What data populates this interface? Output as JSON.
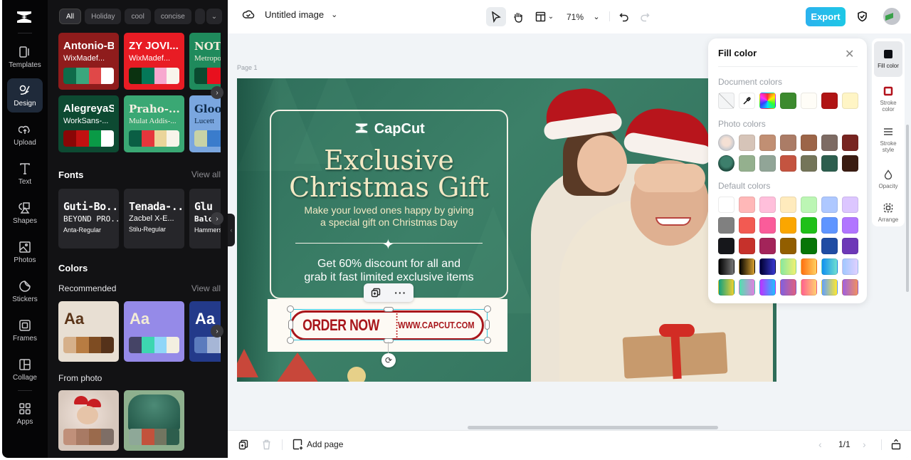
{
  "rail": {
    "items": [
      {
        "label": "Templates",
        "icon": "templates-icon"
      },
      {
        "label": "Design",
        "icon": "design-icon",
        "active": true
      },
      {
        "label": "Upload",
        "icon": "upload-icon"
      },
      {
        "label": "Text",
        "icon": "text-icon"
      },
      {
        "label": "Shapes",
        "icon": "shapes-icon"
      },
      {
        "label": "Photos",
        "icon": "photos-icon"
      },
      {
        "label": "Stickers",
        "icon": "stickers-icon"
      },
      {
        "label": "Frames",
        "icon": "frames-icon"
      },
      {
        "label": "Collage",
        "icon": "collage-icon"
      },
      {
        "label": "Apps",
        "icon": "apps-icon"
      }
    ]
  },
  "panel": {
    "chips": [
      "All",
      "Holiday",
      "cool",
      "concise"
    ],
    "themes": [
      {
        "title": "Antonio-Bold",
        "subtitle": "WixMadef...",
        "bg": "#8f1c1c",
        "fg": "#ffffff",
        "palette": [
          "#0f6b4a",
          "#3aa77d",
          "#e04848",
          "#ffffff"
        ]
      },
      {
        "title": "ZY JOVI...",
        "subtitle": "WixMadef...",
        "bg": "#e81c24",
        "fg": "#ffffff",
        "palette": [
          "#0b3210",
          "#047858",
          "#f7a8cf",
          "#f8f5ec"
        ]
      },
      {
        "title": "NOT",
        "subtitle": "Metropo",
        "bg": "#1f8a5c",
        "fg": "#f1ecd8",
        "palette": [
          "#0a4a30",
          "#e8101e",
          "#e8101e",
          "#e8101e"
        ]
      },
      {
        "title": "AlegreyaS...",
        "subtitle": "WorkSans-...",
        "bg": "#0d4a32",
        "fg": "#ffffff",
        "palette": [
          "#8a0606",
          "#c11111",
          "#0a9a46",
          "#ffffff"
        ]
      },
      {
        "title": "Praho-...",
        "subtitle": "Mulat Addis-...",
        "bg": "#3aa874",
        "fg": "#f3efe2",
        "palette": [
          "#0a5e44",
          "#e6363c",
          "#ead59a",
          "#f7f4ea"
        ]
      },
      {
        "title": "Gloo",
        "subtitle": "Lucett",
        "bg": "#7aa6df",
        "fg": "#0e2a4a",
        "palette": [
          "#c8d2a6",
          "#3a7ccc",
          "#3a7ccc",
          "#55551a"
        ]
      }
    ],
    "fonts": {
      "title": "Fonts",
      "view_all": "View all",
      "cards": [
        {
          "l1": "Guti-Bo...",
          "l2": "BEYOND PRO...",
          "l3": "Anta-Regular"
        },
        {
          "l1": "Tenada-...",
          "l2": "Zacbel X-E...",
          "l3": "Stilu-Regular"
        },
        {
          "l1": "Glu",
          "l2": "Balo",
          "l3": "Hammersm"
        }
      ]
    },
    "colors": {
      "title": "Colors",
      "recommended": "Recommended",
      "view_all": "View all",
      "cards": [
        {
          "aa": "Aa",
          "bg": "#e8dfd3",
          "fg": "#5a3418",
          "palette": [
            "#d6b08a",
            "#b87c42",
            "#7e4c22",
            "#55321a"
          ]
        },
        {
          "aa": "Aa",
          "bg": "#958ae8",
          "fg": "#f3ecd5",
          "palette": [
            "#454466",
            "#3dd6b0",
            "#90d6f8",
            "#f3efe0"
          ]
        },
        {
          "aa": "Aa",
          "bg": "#233a8a",
          "fg": "#ffffff",
          "palette": [
            "#5b7bbd",
            "#a6b6d6",
            "#ffffff",
            "#ffffff"
          ]
        }
      ],
      "from_photo": "From photo",
      "photo_cards": [
        {
          "bg": "#d7c8bd",
          "palette": [
            "#c0907a",
            "#a87a64",
            "#9a6a4c",
            "#7e6e66"
          ]
        },
        {
          "bg": "#8eb08e",
          "palette": [
            "#8ea898",
            "#c2523c",
            "#727560",
            "#2d5e4d"
          ]
        }
      ]
    }
  },
  "topbar": {
    "title": "Untitled image",
    "zoom": "71%",
    "export": "Export"
  },
  "canvas": {
    "page_label": "Page 1",
    "design": {
      "brand": "CapCut",
      "headline_1": "Exclusive",
      "headline_2": "Christmas Gift",
      "sub_1": "Make your loved ones happy by giving",
      "sub_2": "a special gift on Christmas Day",
      "disc_1": "Get 60% discount for all and",
      "disc_2": "grab it fast limited exclusive items",
      "order": "ORDER NOW",
      "url": "WWW.CAPCUT.COM"
    }
  },
  "fill_panel": {
    "title": "Fill color",
    "document_label": "Document colors",
    "document_colors": [
      "#3c8a2e",
      "#fffdf7",
      "#b01414",
      "#fff5c5"
    ],
    "photo_label": "Photo colors",
    "photo_row_1": [
      "#d6c4b8",
      "#c18f73",
      "#ab7c66",
      "#9c6548",
      "#7d6b63",
      "#772420"
    ],
    "photo_row_2": [
      "#94b08e",
      "#91a597",
      "#c45440",
      "#747559",
      "#2d5e4e",
      "#3a1c12"
    ],
    "default_label": "Default colors",
    "default_rows": [
      [
        "#ffffff",
        "#ffb8b8",
        "#ffbfdb",
        "#ffebbd",
        "#bcf6b4",
        "#aec8ff",
        "#dcc6ff"
      ],
      [
        "#808080",
        "#f25a52",
        "#fa5c9a",
        "#fba600",
        "#1fc018",
        "#5f95ff",
        "#b175ff"
      ],
      [
        "#16171b",
        "#c6312b",
        "#a3245a",
        "#925e00",
        "#077507",
        "#1f4ca3",
        "#6d38b7"
      ]
    ],
    "gradient_rows": [
      [
        "linear-gradient(90deg,#000,#777)",
        "linear-gradient(90deg,#000,#d8a030)",
        "linear-gradient(90deg,#000030,#3838d0)",
        "linear-gradient(90deg,#88e8a0,#f0f070)",
        "linear-gradient(90deg,#ff7010,#ffd060)",
        "linear-gradient(90deg,#1090f0,#70e0d0)",
        "linear-gradient(90deg,#a0c8ff,#e0d0ff)"
      ],
      [
        "linear-gradient(90deg,#10a080,#f0d030)",
        "linear-gradient(90deg,#50e0b0,#e080e0)",
        "linear-gradient(90deg,#c030ff,#20c0ff)",
        "linear-gradient(90deg,#8060e0,#e06080)",
        "linear-gradient(90deg,#ff6090,#ffd070)",
        "linear-gradient(90deg,#60a0ff,#ffe830)",
        "linear-gradient(90deg,#a060e0,#f09060)"
      ]
    ]
  },
  "right_rail": {
    "items": [
      {
        "label": "Fill color",
        "active": true
      },
      {
        "label": "Stroke color"
      },
      {
        "label": "Stroke style"
      },
      {
        "label": "Opacity"
      },
      {
        "label": "Arrange"
      }
    ]
  },
  "bottombar": {
    "add_page": "Add page",
    "page_count": "1/1"
  }
}
